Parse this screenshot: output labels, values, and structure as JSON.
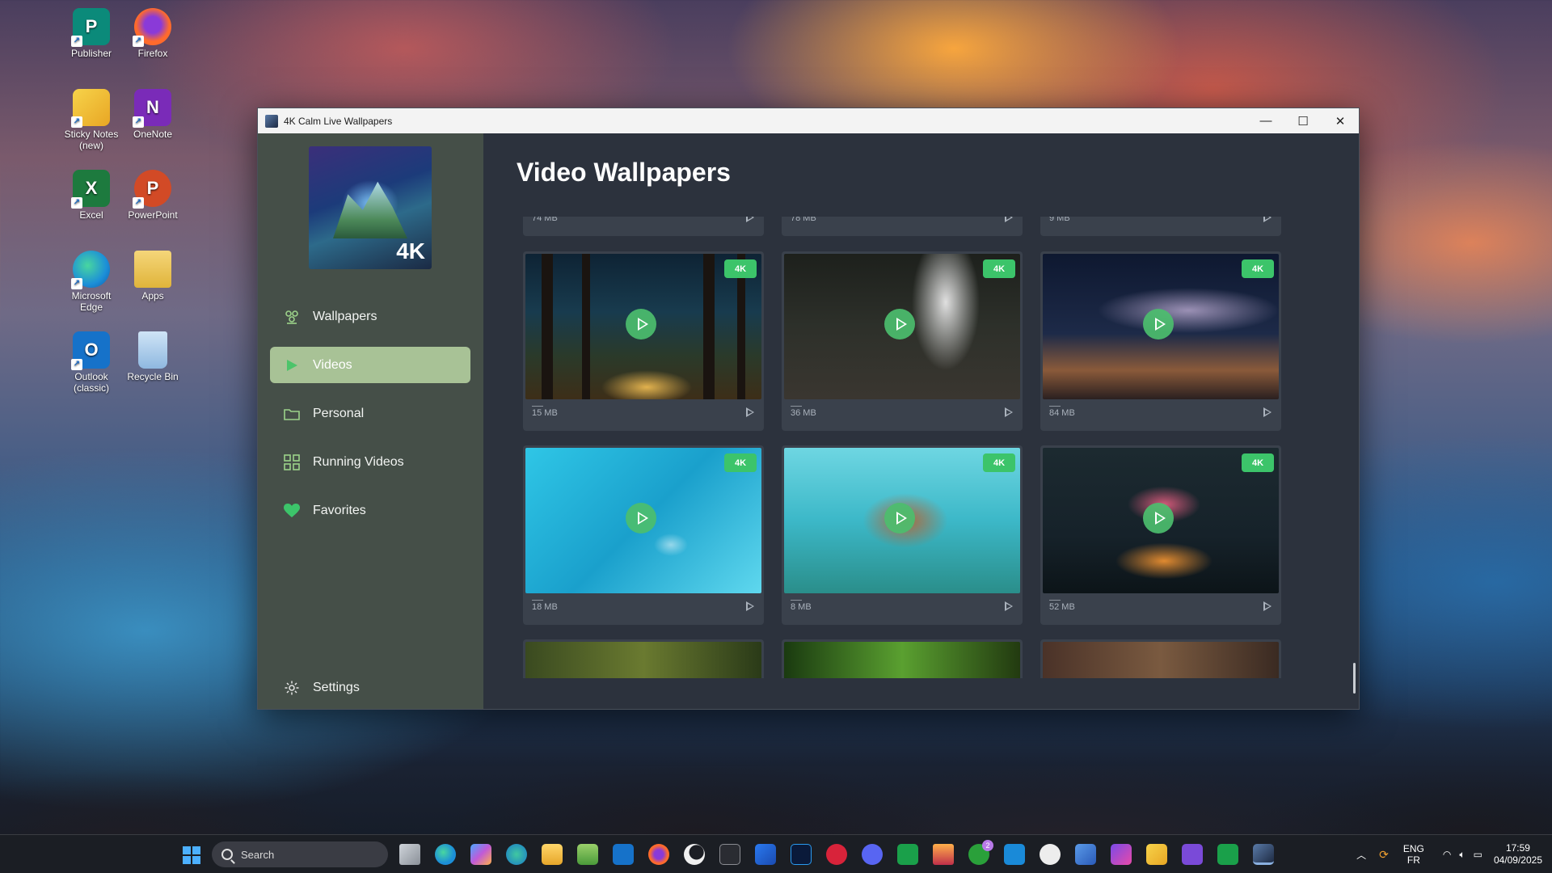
{
  "desktop": {
    "icons": [
      {
        "label": "Publisher",
        "letter": "P",
        "color": "#0b8a7a"
      },
      {
        "label": "Firefox",
        "letter": "",
        "color": "#ff6a2c"
      },
      {
        "label": "Sticky Notes (new)",
        "letter": "",
        "color": "#f2c12c"
      },
      {
        "label": "OneNote",
        "letter": "N",
        "color": "#7a2bb8"
      },
      {
        "label": "Excel",
        "letter": "X",
        "color": "#1d7a3e"
      },
      {
        "label": "PowerPoint",
        "letter": "P",
        "color": "#d24a26"
      },
      {
        "label": "Microsoft Edge",
        "letter": "",
        "color": "#1c8fd8"
      },
      {
        "label": "Apps",
        "letter": "",
        "color": "#e8c04a"
      },
      {
        "label": "Outlook (classic)",
        "letter": "O",
        "color": "#1672c9"
      },
      {
        "label": "Recycle Bin",
        "letter": "",
        "color": "#8fb8e0"
      }
    ]
  },
  "window": {
    "title": "4K Calm Live Wallpapers",
    "controls": {
      "minimize": "—",
      "maximize": "☐",
      "close": "✕"
    }
  },
  "sidebar": {
    "logo_badge": "4K",
    "items": [
      {
        "label": "Wallpapers",
        "icon": "wallpapers-icon",
        "active": false
      },
      {
        "label": "Videos",
        "icon": "play-icon",
        "active": true
      },
      {
        "label": "Personal",
        "icon": "folder-icon",
        "active": false
      },
      {
        "label": "Running Videos",
        "icon": "grid-icon",
        "active": false
      },
      {
        "label": "Favorites",
        "icon": "heart-icon",
        "active": false
      }
    ],
    "settings_label": "Settings",
    "accent": "#3cc46a"
  },
  "main": {
    "title": "Video Wallpapers",
    "cards_top": [
      {
        "size": "74 MB"
      },
      {
        "size": "78 MB"
      },
      {
        "size": "9 MB"
      }
    ],
    "cards": [
      {
        "size": "15 MB",
        "badge": "4K",
        "theme": "forest"
      },
      {
        "size": "36 MB",
        "badge": "4K",
        "theme": "waterfall"
      },
      {
        "size": "84 MB",
        "badge": "4K",
        "theme": "milky-way"
      },
      {
        "size": "18 MB",
        "badge": "4K",
        "theme": "pool"
      },
      {
        "size": "8 MB",
        "badge": "4K",
        "theme": "turtle"
      },
      {
        "size": "52 MB",
        "badge": "4K",
        "theme": "mushroom"
      }
    ]
  },
  "taskbar": {
    "search_placeholder": "Search",
    "language_top": "ENG",
    "language_bottom": "FR",
    "time": "17:59",
    "date": "04/09/2025",
    "xbox_badge": "2"
  }
}
